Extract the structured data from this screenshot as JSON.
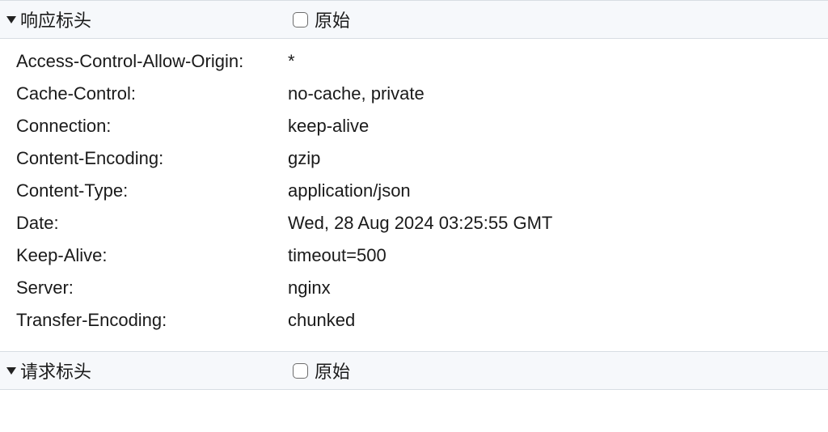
{
  "sections": {
    "response": {
      "title": "响应标头",
      "raw_label": "原始",
      "headers": [
        {
          "name": "Access-Control-Allow-Origin:",
          "value": "*"
        },
        {
          "name": "Cache-Control:",
          "value": "no-cache, private"
        },
        {
          "name": "Connection:",
          "value": "keep-alive"
        },
        {
          "name": "Content-Encoding:",
          "value": "gzip"
        },
        {
          "name": "Content-Type:",
          "value": "application/json"
        },
        {
          "name": "Date:",
          "value": "Wed, 28 Aug 2024 03:25:55 GMT"
        },
        {
          "name": "Keep-Alive:",
          "value": "timeout=500"
        },
        {
          "name": "Server:",
          "value": "nginx"
        },
        {
          "name": "Transfer-Encoding:",
          "value": "chunked"
        }
      ]
    },
    "request": {
      "title": "请求标头",
      "raw_label": "原始"
    }
  }
}
